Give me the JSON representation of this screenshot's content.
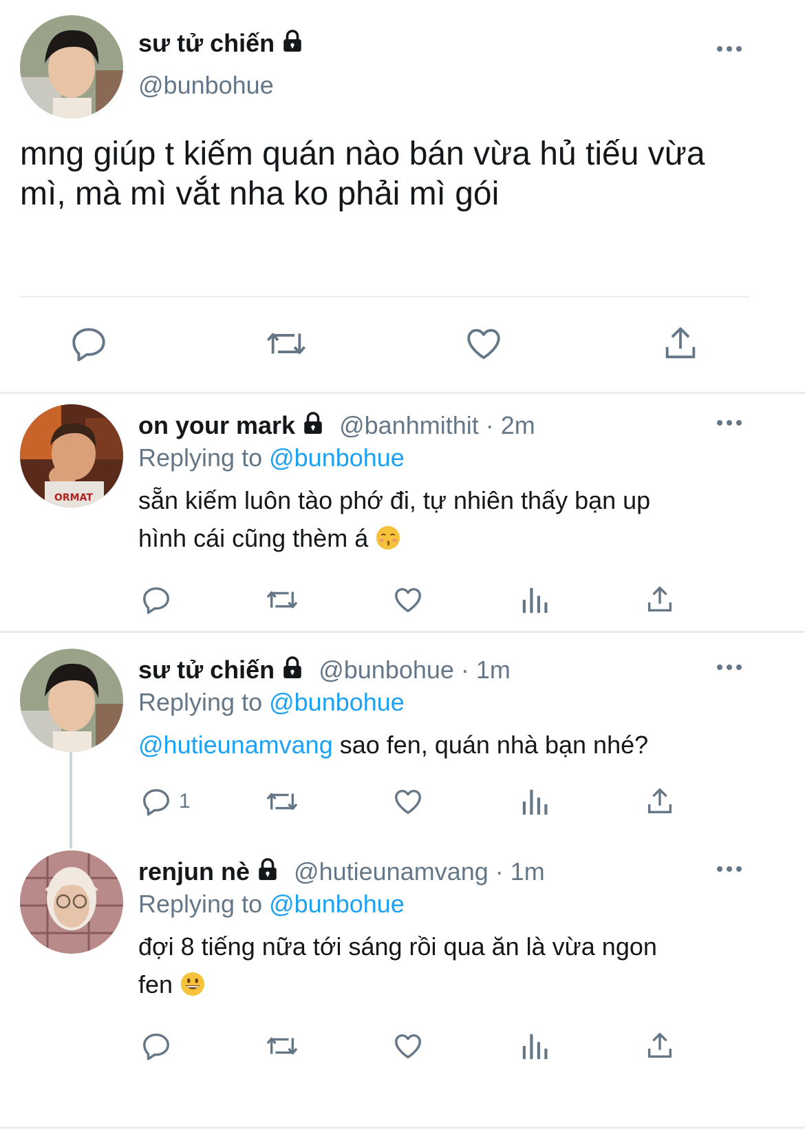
{
  "main_tweet": {
    "display_name": "sư tử chiến",
    "handle": "@bunbohue",
    "text_line1": "mng giúp t kiếm quán nào bán vừa hủ tiếu vừa",
    "text_line2": "mì, mà mì vắt nha ko phải mì gói"
  },
  "replies": [
    {
      "display_name": "on your mark",
      "handle": "@banhmithit",
      "time": " · 2m",
      "replying_label": "Replying to ",
      "replying_to": "@bunbohue",
      "text_line1": "sẵn kiếm luôn tào phớ đi, tự nhiên thấy bạn up",
      "text_line2": "hình cái cũng thèm á",
      "emoji": "kissing-face-closed-eyes"
    },
    {
      "display_name": "sư tử chiến",
      "handle": "@bunbohue",
      "time": " · 1m",
      "replying_label": "Replying to ",
      "replying_to": "@bunbohue",
      "mention": "@hutieunamvang",
      "text_line1": " sao fen, quán nhà bạn nhé?",
      "reply_count": "1"
    },
    {
      "display_name": "renjun nè",
      "handle": "@hutieunamvang",
      "time": " · 1m",
      "replying_label": "Replying to ",
      "replying_to": "@bunbohue",
      "text_line1": "đợi 8 tiếng nữa tới sáng rồi qua ăn là vừa ngon",
      "text_line2": "fen",
      "emoji": "grinning-face"
    }
  ],
  "colors": {
    "link": "#1da1f2",
    "secondary": "#657786",
    "divider": "#e6ecf0"
  }
}
